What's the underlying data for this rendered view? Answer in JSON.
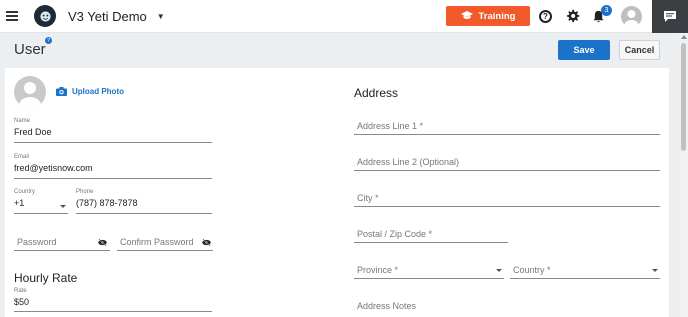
{
  "topbar": {
    "company_name": "V3 Yeti Demo",
    "training_label": "Training",
    "notification_count": "3"
  },
  "header": {
    "title": "User",
    "help_mark": "?",
    "save_label": "Save",
    "cancel_label": "Cancel"
  },
  "profile": {
    "upload_label": "Upload Photo"
  },
  "form": {
    "name_label": "Name",
    "name_value": "Fred Doe",
    "email_label": "Email",
    "email_value": "fred@yetisnow.com",
    "country_label": "Country",
    "country_value": "+1",
    "phone_label": "Phone",
    "phone_value": "(787) 878-7878",
    "password_placeholder": "Password",
    "confirm_password_placeholder": "Confirm Password",
    "hourly_rate_title": "Hourly Rate",
    "rate_label": "Rate",
    "rate_value": "$50"
  },
  "address": {
    "title": "Address",
    "line1_placeholder": "Address Line 1 *",
    "line2_placeholder": "Address Line 2 (Optional)",
    "city_placeholder": "City *",
    "postal_placeholder": "Postal / Zip Code *",
    "province_placeholder": "Province *",
    "country_placeholder": "Country *",
    "notes_placeholder": "Address Notes"
  },
  "colors": {
    "accent": "#1a73c8",
    "training": "#f1592a",
    "chat_button": "#3b3f44"
  },
  "icons": [
    "menu-icon",
    "yeti-logo-icon",
    "graduation-cap-icon",
    "help-icon",
    "gear-icon",
    "bell-icon",
    "user-avatar-icon",
    "chat-icon",
    "camera-icon",
    "eye-off-icon",
    "chevron-down-icon"
  ]
}
